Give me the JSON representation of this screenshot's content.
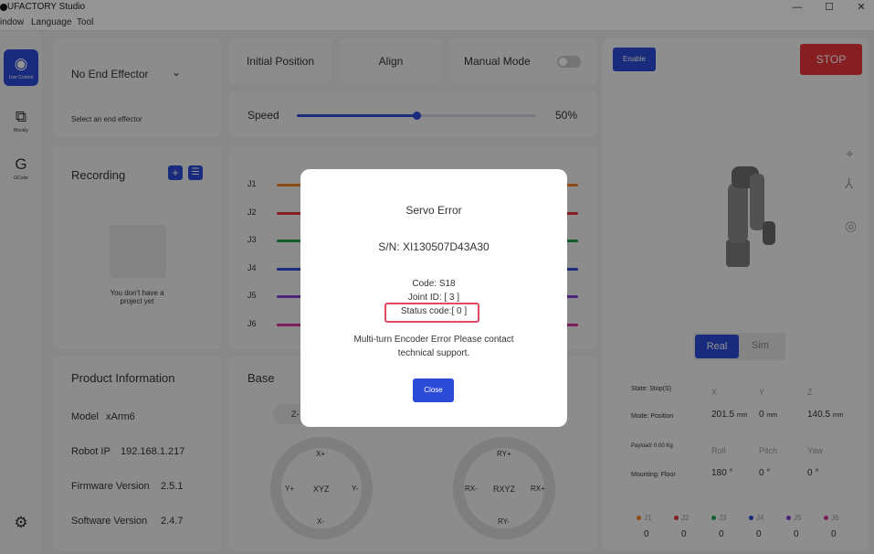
{
  "window": {
    "title": "UFACTORY Studio",
    "minimize": "—",
    "maximize": "☐",
    "close": "✕"
  },
  "menu": {
    "items": [
      "indow",
      "Language",
      "Tool"
    ]
  },
  "rail": {
    "live_control": "Live Control",
    "blockly": "Blockly",
    "gcode": "GCode",
    "gcode_glyph": "G"
  },
  "end_effector": {
    "selected": "No End Effector",
    "hint": "Select an end effector"
  },
  "recording": {
    "title": "Recording",
    "empty": "You don't have a project yet",
    "add": "+",
    "list": "☰"
  },
  "product_info": {
    "title": "Product Information",
    "model_label": "Model",
    "model": "xArm6",
    "ip_label": "Robot IP",
    "ip": "192.168.1.217",
    "firmware_label": "Firmware Version",
    "firmware": "2.5.1",
    "software_label": "Software Version",
    "software": "2.4.7"
  },
  "controls": {
    "initial_position": "Initial Position",
    "align": "Align",
    "manual_mode": "Manual Mode",
    "speed_label": "Speed",
    "speed_value": "50%",
    "speed_fraction": 0.5
  },
  "joints": {
    "labels": [
      "J1",
      "J2",
      "J3",
      "J4",
      "J5",
      "J6"
    ],
    "colors": [
      "#f5821f",
      "#e8343c",
      "#1aa34a",
      "#2b4bd6",
      "#7b3fd0",
      "#d6339c"
    ]
  },
  "base": {
    "title": "Base",
    "z_minus": "Z-",
    "pad1": {
      "top": "X+",
      "bottom": "X-",
      "left": "Y+",
      "right": "Y-",
      "center": "XYZ"
    },
    "pad2": {
      "top": "RY+",
      "bottom": "RY-",
      "left": "RX-",
      "right": "RX+",
      "center": "RXYZ"
    }
  },
  "right_panel": {
    "enable": "Enable",
    "stop": "STOP",
    "real": "Real",
    "sim": "Sim",
    "state_label": "State:",
    "state": "Stop(S)",
    "mode_label": "Mode:",
    "mode": "Position",
    "payload_label": "Payload:",
    "payload": "0.00 Kg",
    "mounting_label": "Mounting:",
    "mounting": "Floor",
    "x_label": "X",
    "y_label": "Y",
    "z_label": "Z",
    "x": "201.5",
    "y": "0",
    "z": "140.5",
    "unit_mm": "mm",
    "roll_label": "Roll",
    "pitch_label": "Pitch",
    "yaw_label": "Yaw",
    "roll": "180",
    "pitch": "0",
    "yaw": "0",
    "unit_deg": "°",
    "joint_legend": [
      "J1",
      "J2",
      "J3",
      "J4",
      "J5",
      "J6"
    ],
    "joint_values": [
      "0",
      "0",
      "0",
      "0",
      "0",
      "0"
    ]
  },
  "modal": {
    "title": "Servo Error",
    "sn_label": "S/N:",
    "sn": "XI130507D43A30",
    "code": "Code: S18",
    "joint": "Joint ID: [ 3 ]",
    "status": "Status code:[ 0 ]",
    "message_line1": "Multi-turn Encoder Error Please contact",
    "message_line2": "technical support.",
    "close": "Close"
  },
  "colors": {
    "accent": "#2b4bd6",
    "stop": "#e8343c",
    "highlight": "#e04b63"
  }
}
